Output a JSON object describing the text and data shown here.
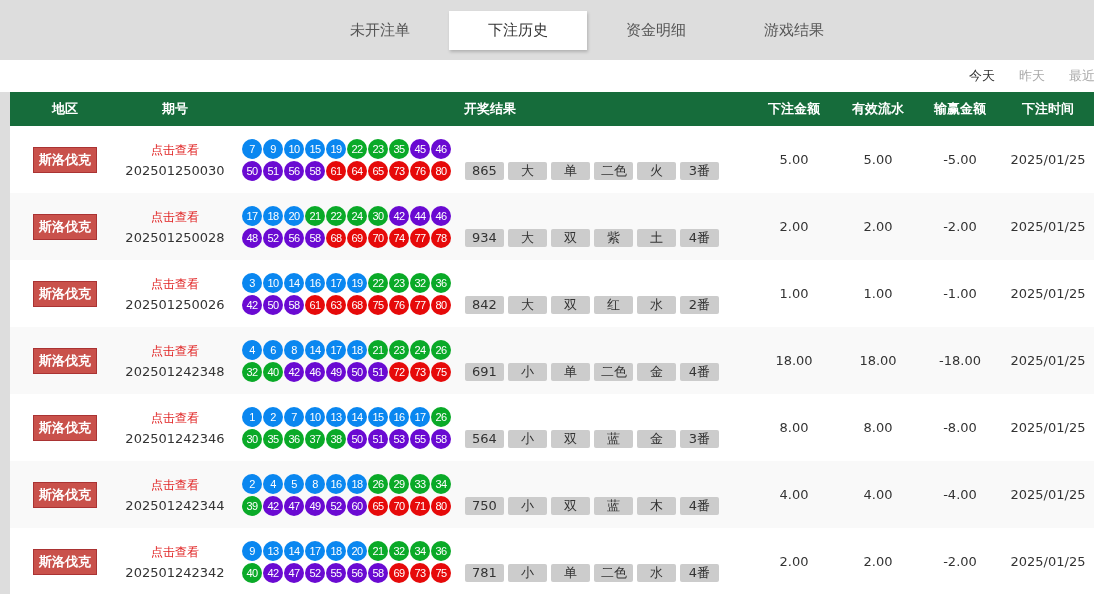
{
  "tabs": [
    {
      "label": "未开注单",
      "selected": false
    },
    {
      "label": "下注历史",
      "selected": true
    },
    {
      "label": "资金明细",
      "selected": false
    },
    {
      "label": "游戏结果",
      "selected": false
    }
  ],
  "date_filter": [
    {
      "label": "今天",
      "selected": true
    },
    {
      "label": "昨天",
      "selected": false
    },
    {
      "label": "最近",
      "selected": false
    }
  ],
  "table": {
    "columns": [
      "地区",
      "期号",
      "开奖结果",
      "下注金额",
      "有效流水",
      "输赢金额",
      "下注时间"
    ],
    "rows": [
      {
        "region": "斯洛伐克",
        "link": "点击查看",
        "period": "202501250030",
        "balls": [
          {
            "n": "7",
            "color": "#0a87f0"
          },
          {
            "n": "9",
            "color": "#0a87f0"
          },
          {
            "n": "10",
            "color": "#0a87f0"
          },
          {
            "n": "15",
            "color": "#0a87f0"
          },
          {
            "n": "19",
            "color": "#0a87f0"
          },
          {
            "n": "22",
            "color": "#0aaa28"
          },
          {
            "n": "23",
            "color": "#0aaa28"
          },
          {
            "n": "35",
            "color": "#0aaa28"
          },
          {
            "n": "45",
            "color": "#6a0ad2"
          },
          {
            "n": "46",
            "color": "#6a0ad2"
          },
          {
            "n": "50",
            "color": "#6a0ad2"
          },
          {
            "n": "51",
            "color": "#6a0ad2"
          },
          {
            "n": "56",
            "color": "#6a0ad2"
          },
          {
            "n": "58",
            "color": "#6a0ad2"
          },
          {
            "n": "61",
            "color": "#e60a0a"
          },
          {
            "n": "64",
            "color": "#e60a0a"
          },
          {
            "n": "65",
            "color": "#e60a0a"
          },
          {
            "n": "73",
            "color": "#e60a0a"
          },
          {
            "n": "76",
            "color": "#e60a0a"
          },
          {
            "n": "80",
            "color": "#e60a0a"
          }
        ],
        "tags": [
          "865",
          "大",
          "单",
          "二色",
          "火",
          "3番"
        ],
        "bet": "5.00",
        "turnover": "5.00",
        "win_loss": "-5.00",
        "time": "2025/01/25"
      },
      {
        "region": "斯洛伐克",
        "link": "点击查看",
        "period": "202501250028",
        "balls": [
          {
            "n": "17",
            "color": "#0a87f0"
          },
          {
            "n": "18",
            "color": "#0a87f0"
          },
          {
            "n": "20",
            "color": "#0a87f0"
          },
          {
            "n": "21",
            "color": "#0aaa28"
          },
          {
            "n": "22",
            "color": "#0aaa28"
          },
          {
            "n": "24",
            "color": "#0aaa28"
          },
          {
            "n": "30",
            "color": "#0aaa28"
          },
          {
            "n": "42",
            "color": "#6a0ad2"
          },
          {
            "n": "44",
            "color": "#6a0ad2"
          },
          {
            "n": "46",
            "color": "#6a0ad2"
          },
          {
            "n": "48",
            "color": "#6a0ad2"
          },
          {
            "n": "52",
            "color": "#6a0ad2"
          },
          {
            "n": "56",
            "color": "#6a0ad2"
          },
          {
            "n": "58",
            "color": "#6a0ad2"
          },
          {
            "n": "68",
            "color": "#e60a0a"
          },
          {
            "n": "69",
            "color": "#e60a0a"
          },
          {
            "n": "70",
            "color": "#e60a0a"
          },
          {
            "n": "74",
            "color": "#e60a0a"
          },
          {
            "n": "77",
            "color": "#e60a0a"
          },
          {
            "n": "78",
            "color": "#e60a0a"
          }
        ],
        "tags": [
          "934",
          "大",
          "双",
          "紫",
          "土",
          "4番"
        ],
        "bet": "2.00",
        "turnover": "2.00",
        "win_loss": "-2.00",
        "time": "2025/01/25"
      },
      {
        "region": "斯洛伐克",
        "link": "点击查看",
        "period": "202501250026",
        "balls": [
          {
            "n": "3",
            "color": "#0a87f0"
          },
          {
            "n": "10",
            "color": "#0a87f0"
          },
          {
            "n": "14",
            "color": "#0a87f0"
          },
          {
            "n": "16",
            "color": "#0a87f0"
          },
          {
            "n": "17",
            "color": "#0a87f0"
          },
          {
            "n": "19",
            "color": "#0a87f0"
          },
          {
            "n": "22",
            "color": "#0aaa28"
          },
          {
            "n": "23",
            "color": "#0aaa28"
          },
          {
            "n": "32",
            "color": "#0aaa28"
          },
          {
            "n": "36",
            "color": "#0aaa28"
          },
          {
            "n": "42",
            "color": "#6a0ad2"
          },
          {
            "n": "50",
            "color": "#6a0ad2"
          },
          {
            "n": "58",
            "color": "#6a0ad2"
          },
          {
            "n": "61",
            "color": "#e60a0a"
          },
          {
            "n": "63",
            "color": "#e60a0a"
          },
          {
            "n": "68",
            "color": "#e60a0a"
          },
          {
            "n": "75",
            "color": "#e60a0a"
          },
          {
            "n": "76",
            "color": "#e60a0a"
          },
          {
            "n": "77",
            "color": "#e60a0a"
          },
          {
            "n": "80",
            "color": "#e60a0a"
          }
        ],
        "tags": [
          "842",
          "大",
          "双",
          "红",
          "水",
          "2番"
        ],
        "bet": "1.00",
        "turnover": "1.00",
        "win_loss": "-1.00",
        "time": "2025/01/25"
      },
      {
        "region": "斯洛伐克",
        "link": "点击查看",
        "period": "202501242348",
        "balls": [
          {
            "n": "4",
            "color": "#0a87f0"
          },
          {
            "n": "6",
            "color": "#0a87f0"
          },
          {
            "n": "8",
            "color": "#0a87f0"
          },
          {
            "n": "14",
            "color": "#0a87f0"
          },
          {
            "n": "17",
            "color": "#0a87f0"
          },
          {
            "n": "18",
            "color": "#0a87f0"
          },
          {
            "n": "21",
            "color": "#0aaa28"
          },
          {
            "n": "23",
            "color": "#0aaa28"
          },
          {
            "n": "24",
            "color": "#0aaa28"
          },
          {
            "n": "26",
            "color": "#0aaa28"
          },
          {
            "n": "32",
            "color": "#0aaa28"
          },
          {
            "n": "40",
            "color": "#0aaa28"
          },
          {
            "n": "42",
            "color": "#6a0ad2"
          },
          {
            "n": "46",
            "color": "#6a0ad2"
          },
          {
            "n": "49",
            "color": "#6a0ad2"
          },
          {
            "n": "50",
            "color": "#6a0ad2"
          },
          {
            "n": "51",
            "color": "#6a0ad2"
          },
          {
            "n": "72",
            "color": "#e60a0a"
          },
          {
            "n": "73",
            "color": "#e60a0a"
          },
          {
            "n": "75",
            "color": "#e60a0a"
          }
        ],
        "tags": [
          "691",
          "小",
          "单",
          "二色",
          "金",
          "4番"
        ],
        "bet": "18.00",
        "turnover": "18.00",
        "win_loss": "-18.00",
        "time": "2025/01/25"
      },
      {
        "region": "斯洛伐克",
        "link": "点击查看",
        "period": "202501242346",
        "balls": [
          {
            "n": "1",
            "color": "#0a87f0"
          },
          {
            "n": "2",
            "color": "#0a87f0"
          },
          {
            "n": "7",
            "color": "#0a87f0"
          },
          {
            "n": "10",
            "color": "#0a87f0"
          },
          {
            "n": "13",
            "color": "#0a87f0"
          },
          {
            "n": "14",
            "color": "#0a87f0"
          },
          {
            "n": "15",
            "color": "#0a87f0"
          },
          {
            "n": "16",
            "color": "#0a87f0"
          },
          {
            "n": "17",
            "color": "#0a87f0"
          },
          {
            "n": "26",
            "color": "#0aaa28"
          },
          {
            "n": "30",
            "color": "#0aaa28"
          },
          {
            "n": "35",
            "color": "#0aaa28"
          },
          {
            "n": "36",
            "color": "#0aaa28"
          },
          {
            "n": "37",
            "color": "#0aaa28"
          },
          {
            "n": "38",
            "color": "#0aaa28"
          },
          {
            "n": "50",
            "color": "#6a0ad2"
          },
          {
            "n": "51",
            "color": "#6a0ad2"
          },
          {
            "n": "53",
            "color": "#6a0ad2"
          },
          {
            "n": "55",
            "color": "#6a0ad2"
          },
          {
            "n": "58",
            "color": "#6a0ad2"
          }
        ],
        "tags": [
          "564",
          "小",
          "双",
          "蓝",
          "金",
          "3番"
        ],
        "bet": "8.00",
        "turnover": "8.00",
        "win_loss": "-8.00",
        "time": "2025/01/25"
      },
      {
        "region": "斯洛伐克",
        "link": "点击查看",
        "period": "202501242344",
        "balls": [
          {
            "n": "2",
            "color": "#0a87f0"
          },
          {
            "n": "4",
            "color": "#0a87f0"
          },
          {
            "n": "5",
            "color": "#0a87f0"
          },
          {
            "n": "8",
            "color": "#0a87f0"
          },
          {
            "n": "16",
            "color": "#0a87f0"
          },
          {
            "n": "18",
            "color": "#0a87f0"
          },
          {
            "n": "26",
            "color": "#0aaa28"
          },
          {
            "n": "29",
            "color": "#0aaa28"
          },
          {
            "n": "33",
            "color": "#0aaa28"
          },
          {
            "n": "34",
            "color": "#0aaa28"
          },
          {
            "n": "39",
            "color": "#0aaa28"
          },
          {
            "n": "42",
            "color": "#6a0ad2"
          },
          {
            "n": "47",
            "color": "#6a0ad2"
          },
          {
            "n": "49",
            "color": "#6a0ad2"
          },
          {
            "n": "52",
            "color": "#6a0ad2"
          },
          {
            "n": "60",
            "color": "#6a0ad2"
          },
          {
            "n": "65",
            "color": "#e60a0a"
          },
          {
            "n": "70",
            "color": "#e60a0a"
          },
          {
            "n": "71",
            "color": "#e60a0a"
          },
          {
            "n": "80",
            "color": "#e60a0a"
          }
        ],
        "tags": [
          "750",
          "小",
          "双",
          "蓝",
          "木",
          "4番"
        ],
        "bet": "4.00",
        "turnover": "4.00",
        "win_loss": "-4.00",
        "time": "2025/01/25"
      },
      {
        "region": "斯洛伐克",
        "link": "点击查看",
        "period": "202501242342",
        "balls": [
          {
            "n": "9",
            "color": "#0a87f0"
          },
          {
            "n": "13",
            "color": "#0a87f0"
          },
          {
            "n": "14",
            "color": "#0a87f0"
          },
          {
            "n": "17",
            "color": "#0a87f0"
          },
          {
            "n": "18",
            "color": "#0a87f0"
          },
          {
            "n": "20",
            "color": "#0a87f0"
          },
          {
            "n": "21",
            "color": "#0aaa28"
          },
          {
            "n": "32",
            "color": "#0aaa28"
          },
          {
            "n": "34",
            "color": "#0aaa28"
          },
          {
            "n": "36",
            "color": "#0aaa28"
          },
          {
            "n": "40",
            "color": "#0aaa28"
          },
          {
            "n": "42",
            "color": "#6a0ad2"
          },
          {
            "n": "47",
            "color": "#6a0ad2"
          },
          {
            "n": "52",
            "color": "#6a0ad2"
          },
          {
            "n": "55",
            "color": "#6a0ad2"
          },
          {
            "n": "56",
            "color": "#6a0ad2"
          },
          {
            "n": "58",
            "color": "#6a0ad2"
          },
          {
            "n": "69",
            "color": "#e60a0a"
          },
          {
            "n": "73",
            "color": "#e60a0a"
          },
          {
            "n": "75",
            "color": "#e60a0a"
          }
        ],
        "tags": [
          "781",
          "小",
          "单",
          "二色",
          "水",
          "4番"
        ],
        "bet": "2.00",
        "turnover": "2.00",
        "win_loss": "-2.00",
        "time": "2025/01/25"
      }
    ]
  }
}
